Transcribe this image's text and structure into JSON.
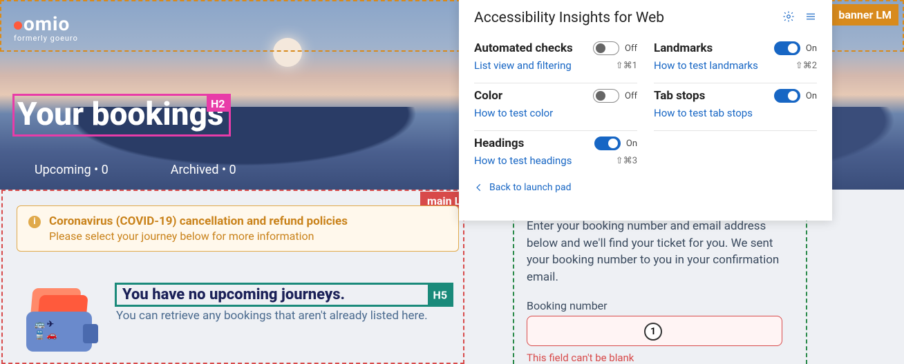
{
  "logo": {
    "main": "omio",
    "sub": "formerly goeuro"
  },
  "banner_tag": "banner LM",
  "heading": {
    "text": "Your bookings",
    "tag": "H2"
  },
  "tabs": [
    {
      "label": "Upcoming • 0"
    },
    {
      "label": "Archived • 0"
    }
  ],
  "main_tag": "main LM",
  "alert": {
    "title": "Coronavirus (COVID-19) cancellation and refund policies",
    "sub": "Please select your journey below for more information"
  },
  "h5": {
    "text": "You have no upcoming journeys.",
    "tag": "H5"
  },
  "h5_sub": "You can retrieve any bookings that aren't already listed here.",
  "form": {
    "intro": "Enter your booking number and email address below and we'll find your ticket for you. We sent your booking number to you in your confirmation email.",
    "label": "Booking number",
    "tabstop": "1",
    "error": "This field can't be blank"
  },
  "panel": {
    "title": "Accessibility Insights for Web",
    "checks": [
      {
        "title": "Automated checks",
        "state": "Off",
        "on": false,
        "link": "List view and filtering",
        "shortcut": "⇧⌘1"
      },
      {
        "title": "Landmarks",
        "state": "On",
        "on": true,
        "link": "How to test landmarks",
        "shortcut": "⇧⌘2"
      },
      {
        "title": "Color",
        "state": "Off",
        "on": false,
        "link": "How to test color",
        "shortcut": ""
      },
      {
        "title": "Tab stops",
        "state": "On",
        "on": true,
        "link": "How to test tab stops",
        "shortcut": ""
      },
      {
        "title": "Headings",
        "state": "On",
        "on": true,
        "link": "How to test headings",
        "shortcut": "⇧⌘3"
      }
    ],
    "back": "Back to launch pad"
  }
}
